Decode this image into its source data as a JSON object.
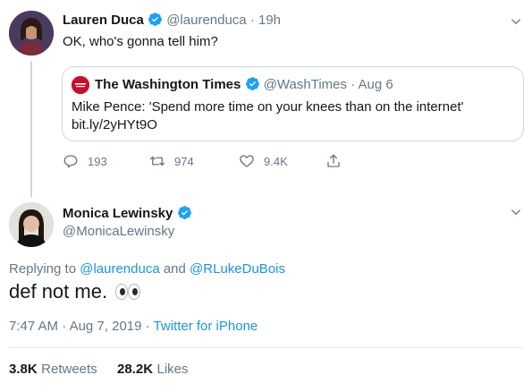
{
  "first_tweet": {
    "author_name": "Lauren Duca",
    "handle": "@laurenduca",
    "sep": "·",
    "time": "19h",
    "text": "OK, who's gonna tell him?",
    "quote": {
      "author_name": "The Washington Times",
      "handle": "@WashTimes",
      "sep": "·",
      "date": "Aug 6",
      "text": "Mike Pence: 'Spend more time on your knees than on the internet'",
      "link": "bit.ly/2yHYt9O"
    },
    "actions": {
      "replies": "193",
      "retweets": "974",
      "likes": "9.4K"
    }
  },
  "main_tweet": {
    "author_name": "Monica Lewinsky",
    "handle": "@MonicaLewinsky",
    "replying_prefix": "Replying to",
    "reply_user_1": "@laurenduca",
    "reply_and": "and",
    "reply_user_2": "@RLukeDuBois",
    "text": "def not me.",
    "time": "7:47 AM",
    "sep1": "·",
    "date": "Aug 7, 2019",
    "sep2": "·",
    "source": "Twitter for iPhone",
    "retweets_count": "3.8K",
    "retweets_label": "Retweets",
    "likes_count": "28.2K",
    "likes_label": "Likes"
  },
  "colors": {
    "verified": "#1da1f2",
    "link": "#1b95e0",
    "muted": "#657786",
    "washtimes_red": "#c8102e"
  }
}
